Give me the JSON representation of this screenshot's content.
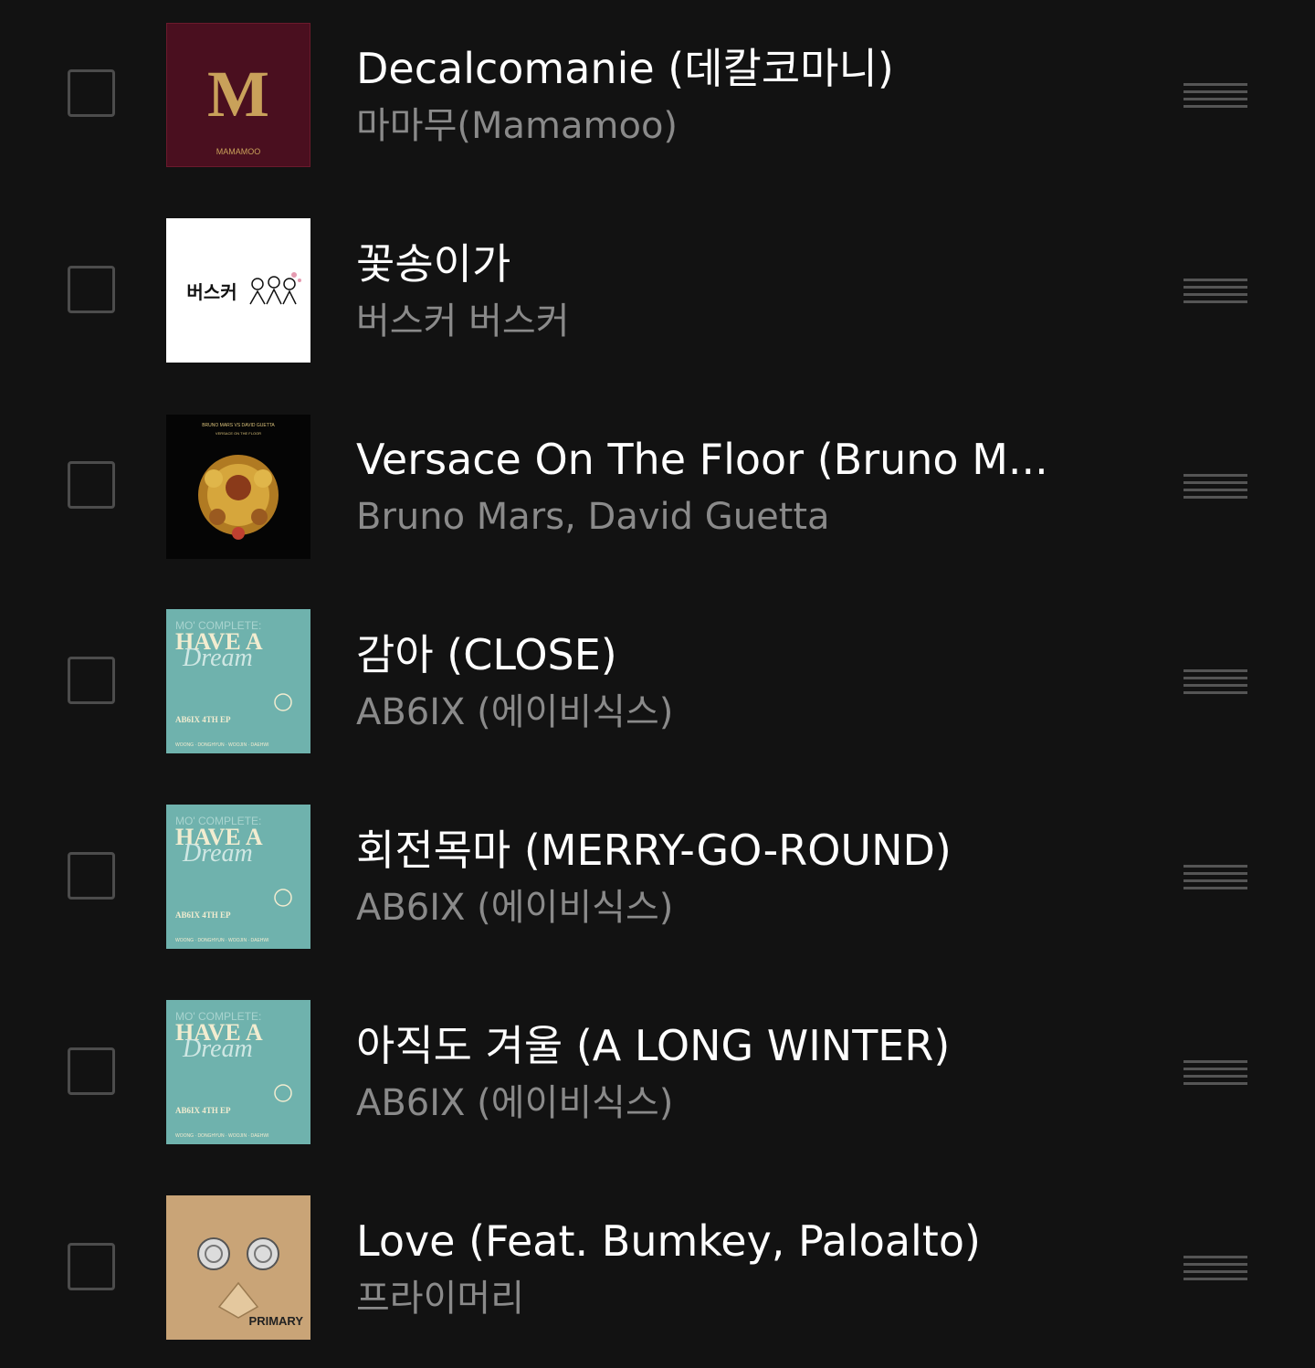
{
  "songs": [
    {
      "title": "Decalcomanie (데칼코마니)",
      "artist": "마마무(Mamamoo)",
      "cover": "mamamoo-cover",
      "cover_text": [
        "M",
        "MAMAMOO"
      ],
      "checked": false
    },
    {
      "title": "꽃송이가",
      "artist": "버스커 버스커",
      "cover": "busker-cover",
      "cover_text": [
        "버스커"
      ],
      "checked": false
    },
    {
      "title": "Versace On The Floor (Bruno M...",
      "artist": "Bruno Mars, David Guetta",
      "cover": "versace-cover",
      "cover_text": [
        "BRUNO MARS VS DAVID GUETTA",
        "VERSACE ON THE FLOOR"
      ],
      "checked": false
    },
    {
      "title": "감아 (CLOSE)",
      "artist": "AB6IX (에이비식스)",
      "cover": "ab6ix-cover",
      "cover_text": [
        "MO' COMPLETE:",
        "HAVE A",
        "Dream",
        "AB6IX 4TH EP",
        "WOONG · DONGHYUN · WOOJIN · DAEHWI"
      ],
      "checked": false
    },
    {
      "title": "회전목마 (MERRY-GO-ROUND)",
      "artist": "AB6IX (에이비식스)",
      "cover": "ab6ix-cover",
      "cover_text": [
        "MO' COMPLETE:",
        "HAVE A",
        "Dream",
        "AB6IX 4TH EP",
        "WOONG · DONGHYUN · WOOJIN · DAEHWI"
      ],
      "checked": false
    },
    {
      "title": "아직도 겨울 (A LONG WINTER)",
      "artist": "AB6IX (에이비식스)",
      "cover": "ab6ix-cover",
      "cover_text": [
        "MO' COMPLETE:",
        "HAVE A",
        "Dream",
        "AB6IX 4TH EP",
        "WOONG · DONGHYUN · WOOJIN · DAEHWI"
      ],
      "checked": false
    },
    {
      "title": "Love (Feat. Bumkey, Paloalto)",
      "artist": "프라이머리",
      "cover": "primary-cover",
      "cover_text": [
        "PRIMARY"
      ],
      "checked": false
    }
  ],
  "icons": {
    "checkbox": "checkbox-icon",
    "drag_handle": "drag-handle-icon"
  },
  "colors": {
    "background": "#121212",
    "title": "#ffffff",
    "artist": "#8a8a8a",
    "checkbox_border": "#4c4c4c",
    "handle": "#555555"
  }
}
